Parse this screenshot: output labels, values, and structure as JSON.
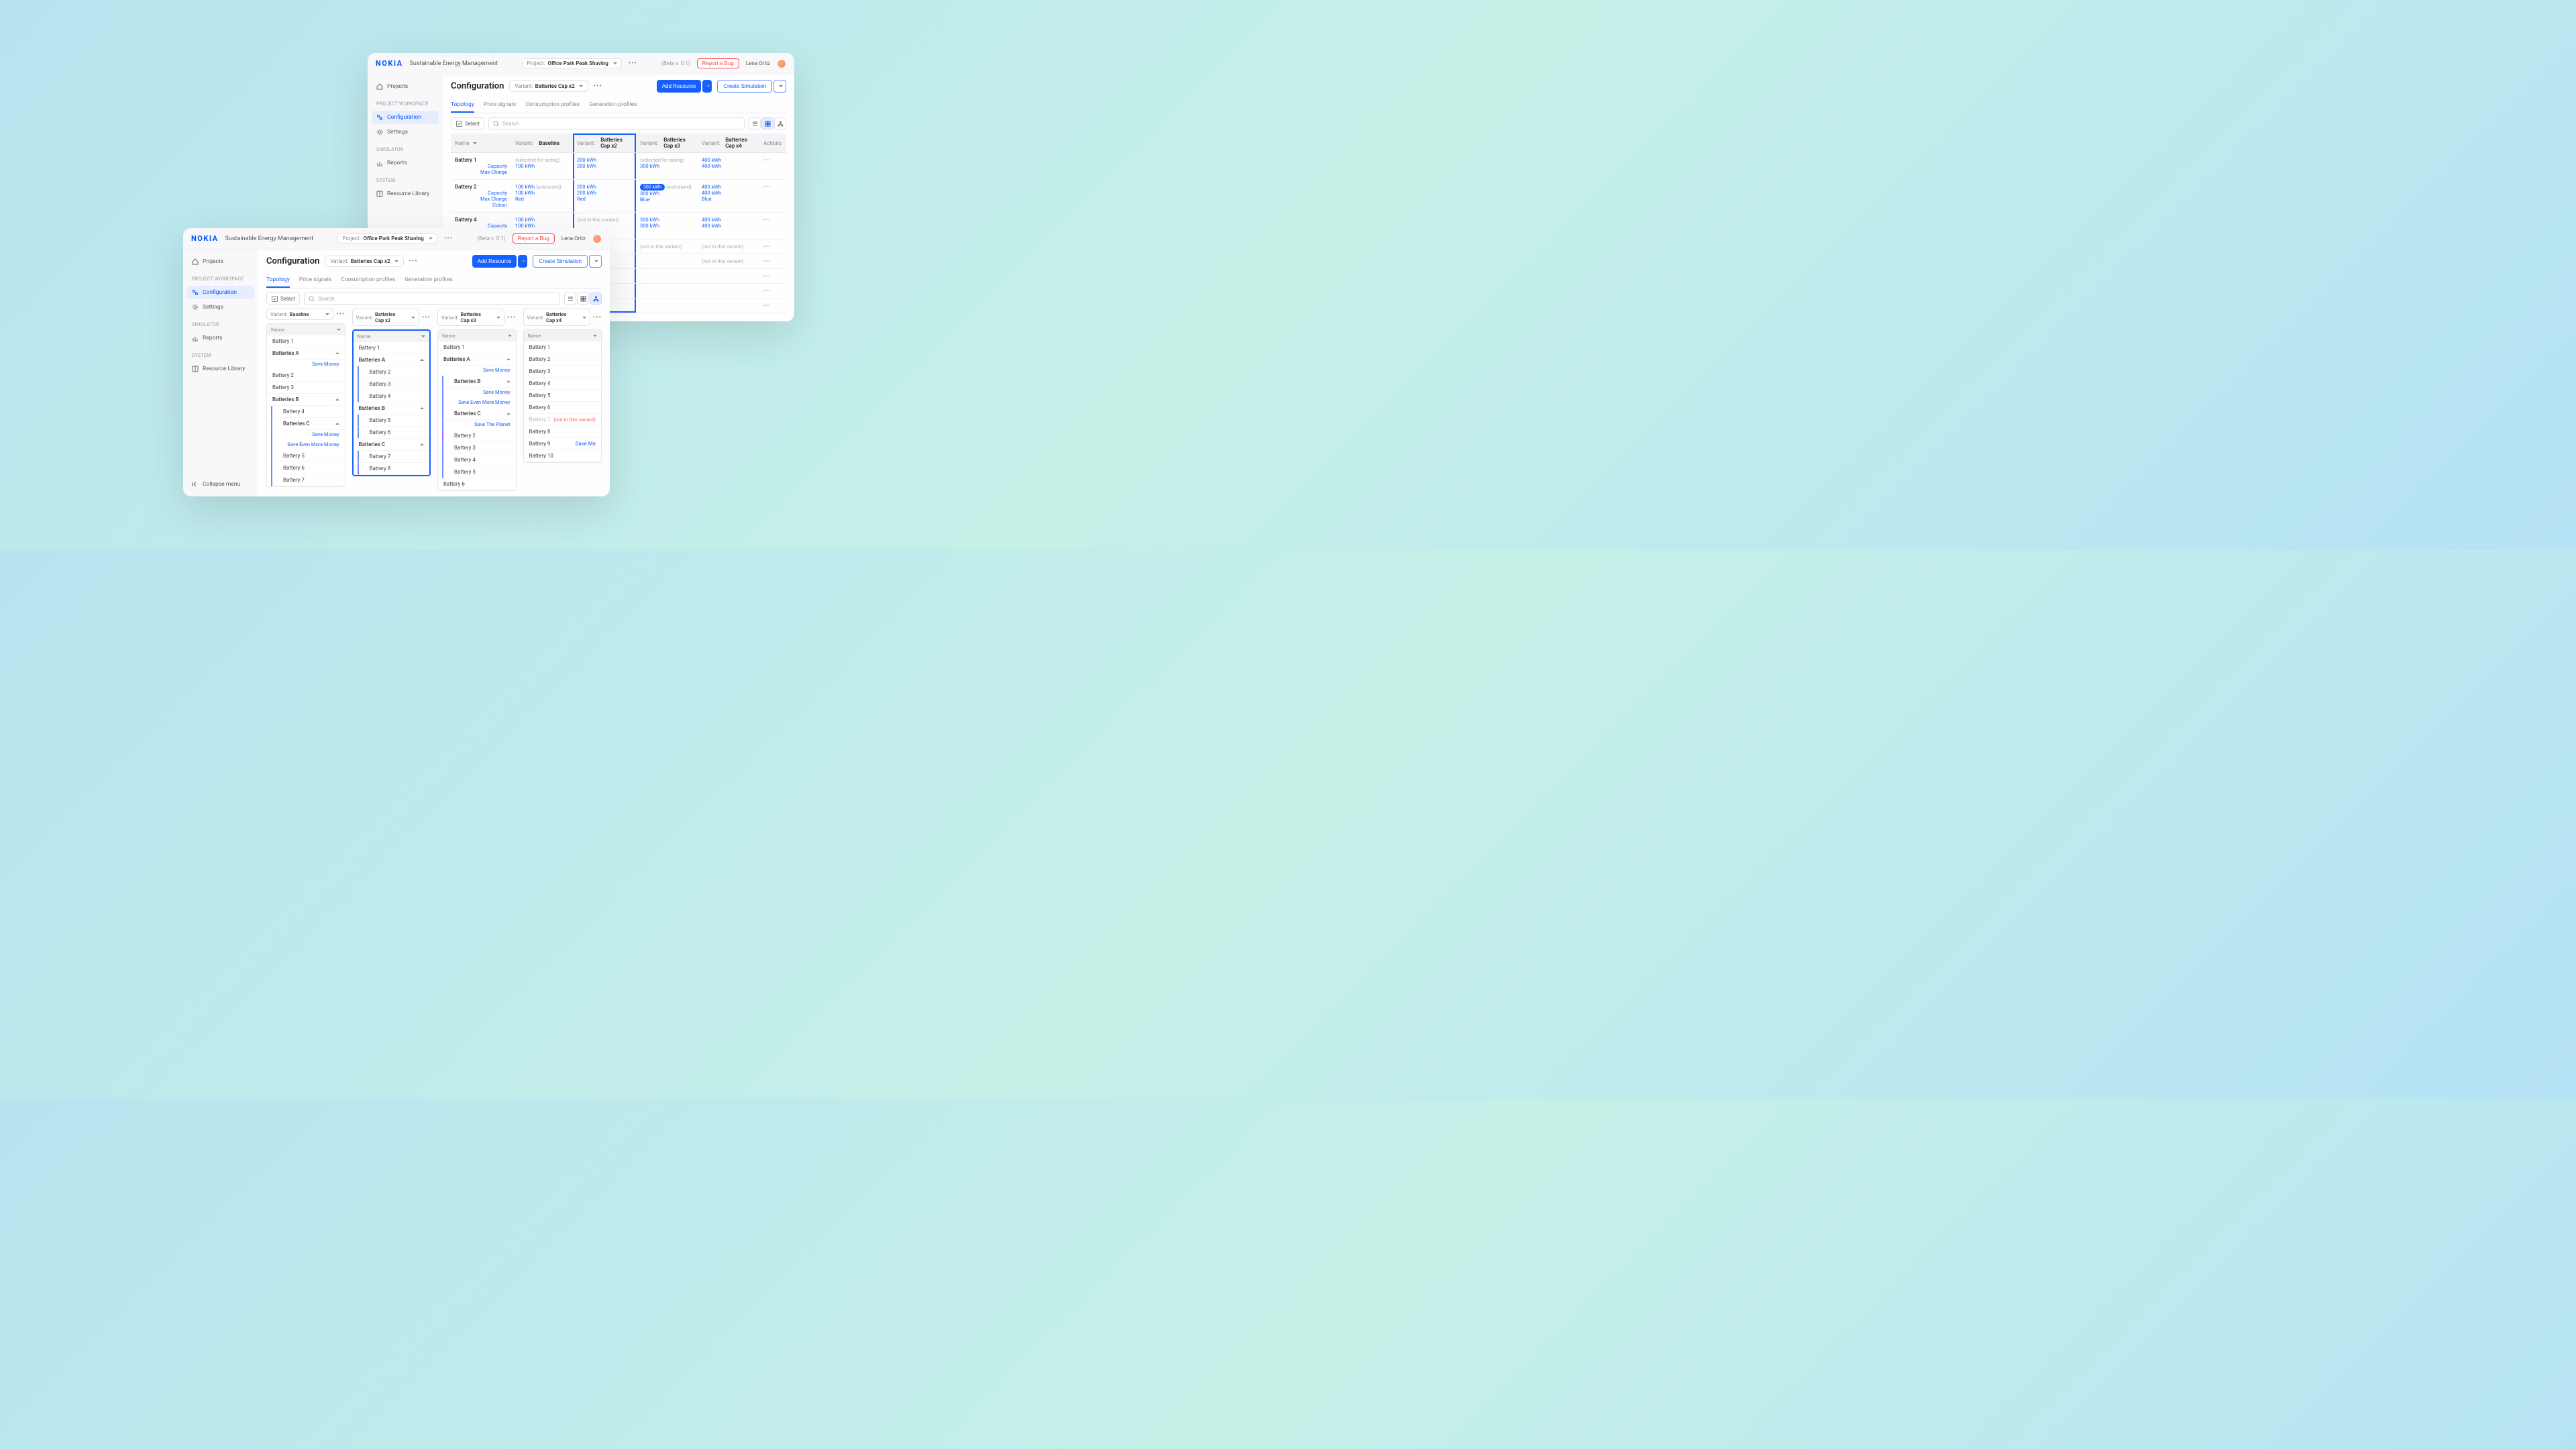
{
  "brand": "NOKIA",
  "app_name": "Sustainable Energy Management",
  "project_label": "Project:",
  "project_name": "Office Park Peak Shaving",
  "beta": "(Beta v. 0.1)",
  "bug": "Report a Bug",
  "user": "Lena Ortiz",
  "sidebar": {
    "projects": "Projects",
    "sec1": "PROJECT WORKSPACE",
    "config": "Configuration",
    "settings": "Settings",
    "sec2": "SIMULATOR",
    "reports": "Reports",
    "sec3": "SYSTEM",
    "reslib": "Resource Library",
    "collapse": "Collapse menu"
  },
  "page_title": "Configuration",
  "variant_label": "Variant:",
  "variant_selected": "Batteries Cap x2",
  "btn_add": "Add Resource",
  "btn_sim": "Create Simulation",
  "tabs": [
    "Topology",
    "Price signals",
    "Consumption profiles",
    "Generation profiles"
  ],
  "select_label": "Select",
  "search_placeholder": "Search",
  "table": {
    "cols": {
      "name": "Name",
      "v1": "Variant:",
      "v1n": "Baseline",
      "v2": "Variant:",
      "v2n": "Batteries Cap x2",
      "v3": "Variant:",
      "v3n": "Batteries Cap x3",
      "v4": "Variant:",
      "v4n": "Batteries Cap x4",
      "actions": "Actions"
    },
    "attrs": {
      "cap": "Capacity",
      "max": "Max Charge",
      "colour": "Colour"
    },
    "rows": [
      {
        "name": "Battery 1",
        "attrs": [
          "cap",
          "max"
        ],
        "v1": {
          "sel": "(selected for sizing)",
          "max": "100 kWh"
        },
        "v2": {
          "cap": "200 kWh",
          "max": "200 kWh"
        },
        "v3": {
          "sel": "(selected for sizing)",
          "max": "300 kWh"
        },
        "v4": {
          "cap": "400 kWh",
          "max": "400 kWh"
        }
      },
      {
        "name": "Battery 2",
        "attrs": [
          "cap",
          "max",
          "colour"
        ],
        "v1": {
          "cap": "100 kWh",
          "cap_note": "(autosized)",
          "max": "100 kWh",
          "colour": "Red"
        },
        "v2": {
          "cap": "200 kWh",
          "max": "200 kWh",
          "colour": "Red"
        },
        "v3": {
          "pill": "300 kWh",
          "pill_note": "(autosized)",
          "max": "300 kWh",
          "colour": "Blue"
        },
        "v4": {
          "cap": "400 kWh",
          "max": "400 kWh",
          "colour": "Blue"
        }
      },
      {
        "name": "Battery 4",
        "attrs": [
          "cap",
          "max"
        ],
        "v1": {
          "cap": "100 kWh",
          "max": "100 kWh"
        },
        "v2": {
          "not": "(not in this variant)"
        },
        "v3": {
          "cap": "300 kWh",
          "max": "300 kWh"
        },
        "v4": {
          "cap": "400 kWh",
          "max": "400 kWh"
        }
      }
    ],
    "not_in_variant": "(not in this variant)"
  },
  "variants": {
    "baseline": {
      "label": "Variant:",
      "name": "Baseline",
      "items": [
        {
          "t": "item",
          "n": "Battery 1"
        },
        {
          "t": "group",
          "n": "Batteries A",
          "subs": [
            "Save Money"
          ]
        },
        {
          "t": "item",
          "n": "Battery 2"
        },
        {
          "t": "item",
          "n": "Battery 3"
        },
        {
          "t": "group",
          "n": "Batteries B"
        },
        {
          "t": "item",
          "n": "Battery 4",
          "nest": 1
        },
        {
          "t": "group",
          "n": "Batteries C",
          "nest": 1,
          "subs": [
            "Save Money",
            "Save Even More Money"
          ]
        },
        {
          "t": "item",
          "n": "Battery 5",
          "nest": 1
        },
        {
          "t": "item",
          "n": "Battery 6",
          "nest": 1
        },
        {
          "t": "item",
          "n": "Battery 7",
          "nest": 1
        }
      ]
    },
    "x2": {
      "label": "Variant:",
      "name": "Batteries Cap x2",
      "items": [
        {
          "t": "item",
          "n": "Battery 1"
        },
        {
          "t": "group",
          "n": "Batteries A"
        },
        {
          "t": "item",
          "n": "Battery 2",
          "nest": 1
        },
        {
          "t": "item",
          "n": "Battery 3",
          "nest": 1
        },
        {
          "t": "item",
          "n": "Battery 4",
          "nest": 1
        },
        {
          "t": "group",
          "n": "Batteries B"
        },
        {
          "t": "item",
          "n": "Battery 5",
          "nest": 1
        },
        {
          "t": "item",
          "n": "Battery 6",
          "nest": 1
        },
        {
          "t": "group",
          "n": "Batteries C"
        },
        {
          "t": "item",
          "n": "Battery 7",
          "nest": 1
        },
        {
          "t": "item",
          "n": "Battery 8",
          "nest": 1
        }
      ]
    },
    "x3": {
      "label": "Variant:",
      "name": "Batteries Cap x3",
      "items": [
        {
          "t": "item",
          "n": "Battery 1"
        },
        {
          "t": "group",
          "n": "Batteries A",
          "subs": [
            "Save Money"
          ]
        },
        {
          "t": "group",
          "n": "Batteries B",
          "nest": 1,
          "subs": [
            "Save Money",
            "Save Even More Money"
          ]
        },
        {
          "t": "group",
          "n": "Batteries C",
          "nest": 1,
          "subs": [
            "Save The Planet"
          ]
        },
        {
          "t": "item",
          "n": "Battery 2",
          "nest": 2
        },
        {
          "t": "item",
          "n": "Battery 3",
          "nest": 1
        },
        {
          "t": "item",
          "n": "Battery 4",
          "nest": 1
        },
        {
          "t": "item",
          "n": "Battery 5",
          "nest": 1
        },
        {
          "t": "item",
          "n": "Battery 6"
        }
      ]
    },
    "x4": {
      "label": "Variant:",
      "name": "Batteries Cap x4",
      "items": [
        {
          "t": "item",
          "n": "Battery 1"
        },
        {
          "t": "item",
          "n": "Battery 2"
        },
        {
          "t": "item",
          "n": "Battery 3"
        },
        {
          "t": "item",
          "n": "Battery 4"
        },
        {
          "t": "item",
          "n": "Battery 5"
        },
        {
          "t": "item",
          "n": "Battery 6"
        },
        {
          "t": "item",
          "n": "Battery 7",
          "dim": true,
          "right": "(not in this variant)"
        },
        {
          "t": "item",
          "n": "Battery 8"
        },
        {
          "t": "item",
          "n": "Battery 9",
          "right": "Save Me",
          "rightblue": true
        },
        {
          "t": "item",
          "n": "Battery 10"
        }
      ]
    }
  }
}
